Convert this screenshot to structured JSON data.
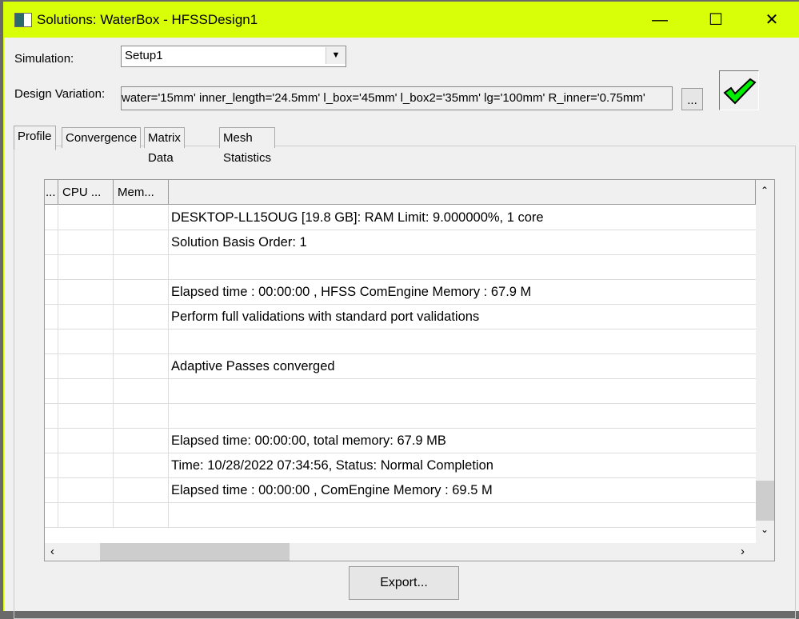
{
  "window": {
    "title": "Solutions: WaterBox - HFSSDesign1",
    "minimize": "—",
    "maximize": "☐",
    "close": "✕"
  },
  "simulation": {
    "label": "Simulation:",
    "value": "Setup1"
  },
  "design_variation": {
    "label": "Design Variation:",
    "value": "water='15mm' inner_length='24.5mm' l_box='45mm' l_box2='35mm' lg='100mm' R_inner='0.75mm'",
    "browse": "..."
  },
  "status_icon": "checkmark-icon",
  "status_color": "#00ee00",
  "tabs": [
    "Profile",
    "Convergence",
    "Matrix Data",
    "Mesh Statistics"
  ],
  "table": {
    "headers": [
      "...",
      "CPU ...",
      "Mem...",
      ""
    ],
    "rows": [
      "DESKTOP-LL15OUG [19.8 GB]: RAM Limit: 9.000000%, 1 core",
      "Solution Basis Order: 1",
      "",
      "Elapsed time : 00:00:00 , HFSS ComEngine Memory : 67.9 M",
      "Perform full validations with standard port validations",
      "",
      "Adaptive Passes converged",
      "",
      "",
      "Elapsed time: 00:00:00, total memory: 67.9 MB",
      "Time:  10/28/2022 07:34:56, Status: Normal Completion",
      "Elapsed time : 00:00:00 , ComEngine Memory : 69.5 M",
      ""
    ]
  },
  "export": "Export..."
}
